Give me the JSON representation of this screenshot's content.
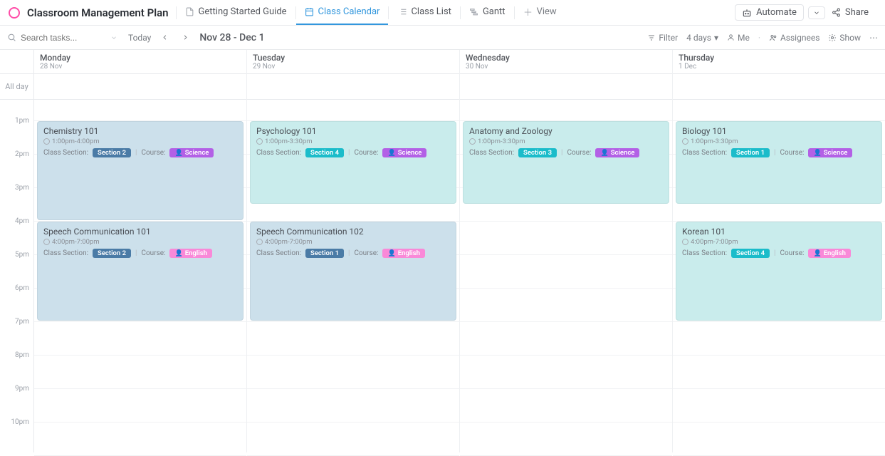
{
  "header": {
    "title": "Classroom Management Plan",
    "tabs": [
      {
        "label": "Getting Started Guide",
        "icon": "doc-icon"
      },
      {
        "label": "Class Calendar",
        "icon": "calendar-icon",
        "active": true
      },
      {
        "label": "Class List",
        "icon": "list-icon"
      },
      {
        "label": "Gantt",
        "icon": "gantt-icon"
      }
    ],
    "addView": "View",
    "automate": "Automate",
    "share": "Share"
  },
  "toolbar": {
    "searchPlaceholder": "Search tasks...",
    "today": "Today",
    "dateRange": "Nov 28 - Dec 1",
    "filter": "Filter",
    "days": "4 days",
    "me": "Me",
    "assignees": "Assignees",
    "show": "Show"
  },
  "allDayLabel": "All day",
  "hours": [
    "1pm",
    "2pm",
    "3pm",
    "4pm",
    "5pm",
    "6pm",
    "7pm",
    "8pm",
    "9pm",
    "10pm"
  ],
  "days": [
    {
      "name": "Monday",
      "date": "28 Nov"
    },
    {
      "name": "Tuesday",
      "date": "29 Nov"
    },
    {
      "name": "Wednesday",
      "date": "30 Nov"
    },
    {
      "name": "Thursday",
      "date": "1 Dec"
    }
  ],
  "labels": {
    "classSection": "Class Section:",
    "course": "Course:"
  },
  "events": {
    "mon1": {
      "title": "Chemistry 101",
      "time": "1:00pm-4:00pm",
      "section": "Section 2",
      "course": "Science"
    },
    "mon2": {
      "title": "Speech Communication 101",
      "time": "4:00pm-7:00pm",
      "section": "Section 2",
      "course": "English"
    },
    "tue1": {
      "title": "Psychology 101",
      "time": "1:00pm-3:30pm",
      "section": "Section 4",
      "course": "Science"
    },
    "tue2": {
      "title": "Speech Communication 102",
      "time": "4:00pm-7:00pm",
      "section": "Section 1",
      "course": "English"
    },
    "wed1": {
      "title": "Anatomy and Zoology",
      "time": "1:00pm-3:30pm",
      "section": "Section 3",
      "course": "Science"
    },
    "thu1": {
      "title": "Biology 101",
      "time": "1:00pm-3:30pm",
      "section": "Section 1",
      "course": "Science"
    },
    "thu2": {
      "title": "Korean 101",
      "time": "4:00pm-7:00pm",
      "section": "Section 4",
      "course": "English"
    }
  }
}
